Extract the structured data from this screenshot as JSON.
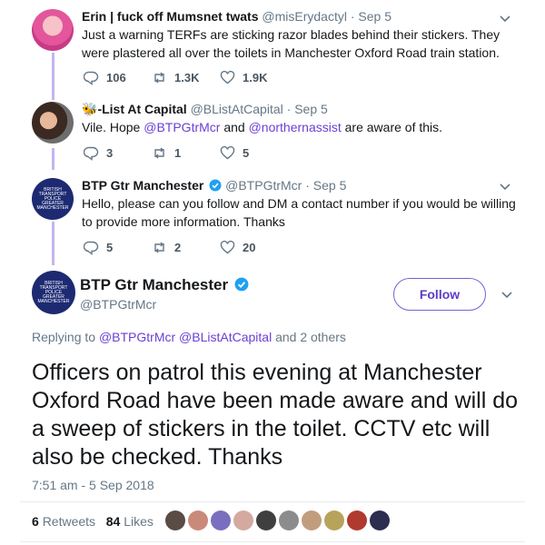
{
  "tweets": [
    {
      "name": "Erin | fuck off Mumsnet twats",
      "handle": "@misErydactyl",
      "time": "· Sep 5",
      "text": "Just a warning TERFs are sticking razor blades behind their stickers. They were plastered all over the toilets in Manchester Oxford Road train station.",
      "replies": "106",
      "retweets": "1.3K",
      "likes": "1.9K"
    },
    {
      "name_emoji": "🐝",
      "name": "-List At Capital",
      "handle": "@BListAtCapital",
      "time": "· Sep 5",
      "text_pre": "Vile. Hope ",
      "mention1": "@BTPGtrMcr",
      "text_mid": " and ",
      "mention2": "@northernassist",
      "text_post": " are aware of this.",
      "replies": "3",
      "retweets": "1",
      "likes": "5"
    },
    {
      "name": "BTP Gtr Manchester",
      "handle": "@BTPGtrMcr",
      "time": "· Sep 5",
      "text": "Hello, please can you follow and DM a contact number if you would be willing to provide more information. Thanks",
      "replies": "5",
      "retweets": "2",
      "likes": "20"
    }
  ],
  "avatar_logo": [
    "BRITISH",
    "TRANSPORT",
    "POLICE",
    "GREATER",
    "MANCHESTER"
  ],
  "main": {
    "name": "BTP Gtr Manchester",
    "handle": "@BTPGtrMcr",
    "follow_label": "Follow",
    "replying_prefix": "Replying to ",
    "replying_mentions": "@BTPGtrMcr @BListAtCapital",
    "replying_suffix": " and 2 others",
    "text": "Officers on patrol this evening at Manchester Oxford Road have been made aware and will do a sweep of stickers in the toilet. CCTV etc will also be checked. Thanks",
    "timestamp": "7:51 am - 5 Sep 2018",
    "retweets_count": "6",
    "retweets_label": "Retweets",
    "likes_count": "84",
    "likes_label": "Likes"
  },
  "colors": {
    "accent": "#6b3fd4",
    "thread_line": "#c4b5f0",
    "muted": "#657786",
    "verified": "#1da1f2"
  },
  "liker_colors": [
    "#5a4b45",
    "#c98a7a",
    "#7a6fbf",
    "#d3a9a0",
    "#3f3f3f",
    "#8c8c8c",
    "#c29d7d",
    "#b7a35a",
    "#b03a2e",
    "#2d2d4f"
  ]
}
